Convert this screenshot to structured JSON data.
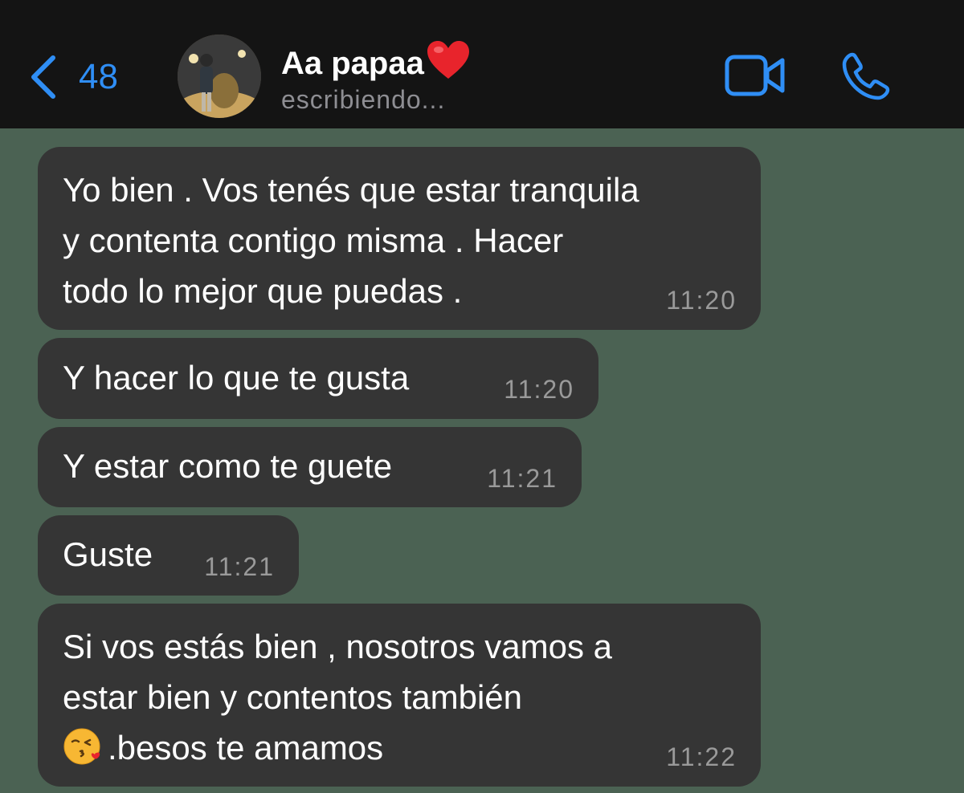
{
  "header": {
    "back_count": "48",
    "contact_name": "Aa papaa",
    "name_emoji": "❤️",
    "status": "escribiendo...",
    "accent_color": "#2f8ef5",
    "icons": [
      "chevron-left-icon",
      "video-camera-icon",
      "phone-icon",
      "heart-icon"
    ]
  },
  "messages": [
    {
      "text": "Yo bien . Vos tenés que estar tranquila\ny contenta contigo misma . Hacer\ntodo lo mejor que puedas  .",
      "time": "11:20"
    },
    {
      "text": "Y hacer lo que te gusta",
      "time": "11:20"
    },
    {
      "text": "Y estar como te guete",
      "time": "11:21"
    },
    {
      "text": "Guste",
      "time": "11:21"
    },
    {
      "text_line1": "Si vos estás bien , nosotros vamos a",
      "text_line2": "estar bien y contentos también",
      "emoji": "😘",
      "text_line3": ".besos te amamos",
      "time": "11:22"
    }
  ],
  "colors": {
    "header_bg": "#141414",
    "chat_bg": "#4b6253",
    "bubble_bg": "#353535",
    "timestamp": "#9a9a9a"
  }
}
